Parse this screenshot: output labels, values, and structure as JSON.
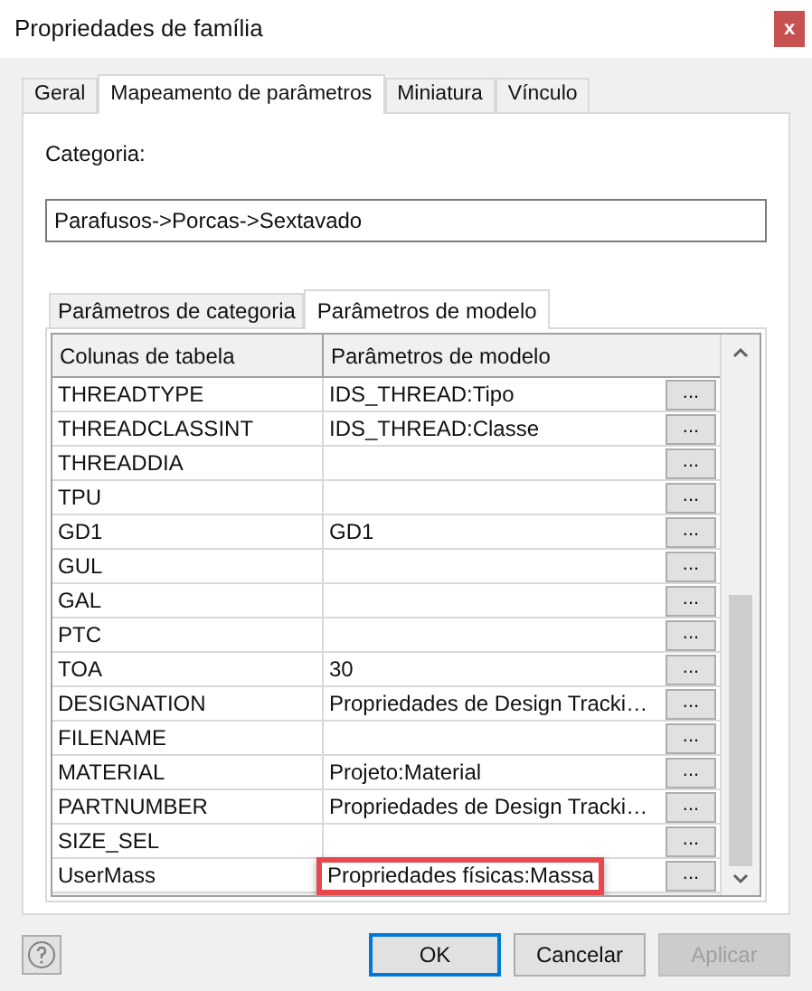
{
  "window": {
    "title": "Propriedades de família",
    "close": "x"
  },
  "tabs": [
    {
      "label": "Geral",
      "selected": false
    },
    {
      "label": "Mapeamento de parâmetros",
      "selected": true
    },
    {
      "label": "Miniatura",
      "selected": false
    },
    {
      "label": "Vínculo",
      "selected": false
    }
  ],
  "category": {
    "label": "Categoria:",
    "value": "Parafusos->Porcas->Sextavado"
  },
  "subtabs": [
    {
      "label": "Parâmetros de categoria",
      "selected": false
    },
    {
      "label": "Parâmetros de modelo",
      "selected": true
    }
  ],
  "table": {
    "columns": [
      "Colunas de tabela",
      "Parâmetros de modelo"
    ],
    "rows": [
      {
        "column": "THREADTYPE",
        "parameter": "IDS_THREAD:Tipo",
        "button": "...",
        "highlighted": false
      },
      {
        "column": "THREADCLASSINT",
        "parameter": "IDS_THREAD:Classe",
        "button": "...",
        "highlighted": false
      },
      {
        "column": "THREADDIA",
        "parameter": "",
        "button": "...",
        "highlighted": false
      },
      {
        "column": "TPU",
        "parameter": "",
        "button": "...",
        "highlighted": false
      },
      {
        "column": "GD1",
        "parameter": "GD1",
        "button": "...",
        "highlighted": false
      },
      {
        "column": "GUL",
        "parameter": "",
        "button": "...",
        "highlighted": false
      },
      {
        "column": "GAL",
        "parameter": "",
        "button": "...",
        "highlighted": false
      },
      {
        "column": "PTC",
        "parameter": "",
        "button": "...",
        "highlighted": false
      },
      {
        "column": "TOA",
        "parameter": "30",
        "button": "...",
        "highlighted": false
      },
      {
        "column": "DESIGNATION",
        "parameter": "Propriedades de Design Tracki…",
        "button": "...",
        "highlighted": false
      },
      {
        "column": "FILENAME",
        "parameter": "",
        "button": "...",
        "highlighted": false
      },
      {
        "column": "MATERIAL",
        "parameter": "Projeto:Material",
        "button": "...",
        "highlighted": false
      },
      {
        "column": "PARTNUMBER",
        "parameter": "Propriedades de Design Tracki…",
        "button": "...",
        "highlighted": false
      },
      {
        "column": "SIZE_SEL",
        "parameter": "",
        "button": "...",
        "highlighted": false
      },
      {
        "column": "UserMass",
        "parameter": "Propriedades físicas:Massa",
        "button": "...",
        "highlighted": true
      }
    ]
  },
  "buttons": [
    {
      "label": "OK",
      "focused": true,
      "disabled": false
    },
    {
      "label": "Cancelar",
      "focused": false,
      "disabled": false
    },
    {
      "label": "Aplicar",
      "focused": false,
      "disabled": true
    }
  ]
}
